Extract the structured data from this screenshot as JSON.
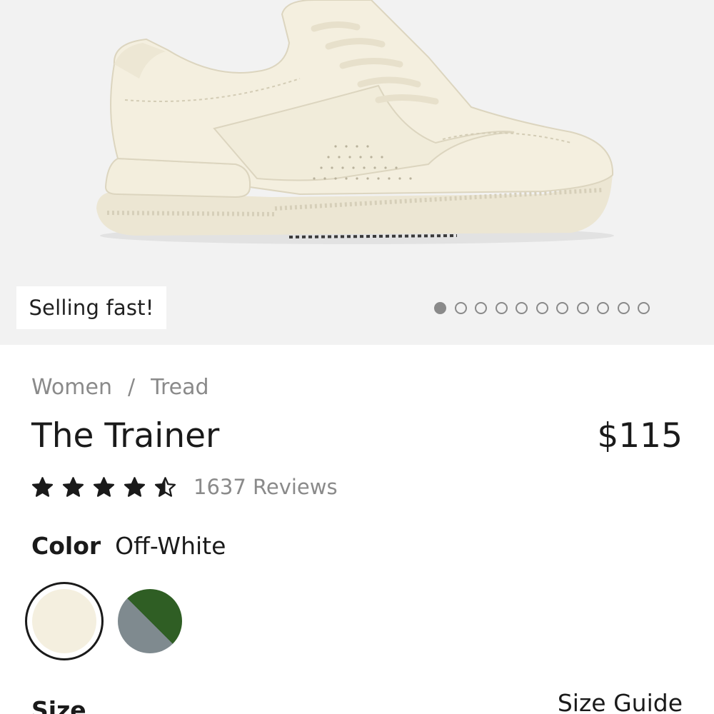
{
  "hero": {
    "badge": "Selling fast!",
    "carousel": {
      "total": 11,
      "active_index": 0
    }
  },
  "breadcrumb": {
    "items": [
      "Women",
      "Tread"
    ],
    "separator": "/"
  },
  "product": {
    "title": "The Trainer",
    "price": "$115",
    "rating": 4.5,
    "rating_max": 5,
    "reviews_label": "1637 Reviews"
  },
  "color": {
    "label": "Color",
    "selected": "Off-White",
    "swatches": [
      {
        "name": "Off-White",
        "colors": [
          "#f4efdf"
        ],
        "selected": true
      },
      {
        "name": "green-grey",
        "colors": [
          "#2f5e24",
          "#7f8a8f"
        ],
        "selected": false
      }
    ]
  },
  "size": {
    "label": "Size",
    "guide_label": "Size Guide"
  },
  "colors": {
    "text": "#1a1a1a",
    "muted": "#8a8a8a",
    "hero_bg": "#f2f2f2"
  }
}
